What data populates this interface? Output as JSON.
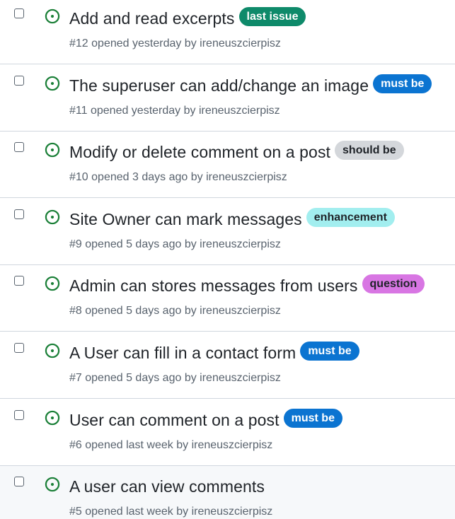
{
  "issues": [
    {
      "title": "Add and read excerpts",
      "number": "#12",
      "opened": "opened yesterday by",
      "author": "ireneuszcierpisz",
      "label": {
        "text": "last issue",
        "bg": "#0e8a6a",
        "fg": "#ffffff"
      },
      "icon": "issue-open-icon"
    },
    {
      "title": "The superuser can add/change an image",
      "number": "#11",
      "opened": "opened yesterday by",
      "author": "ireneuszcierpisz",
      "label": {
        "text": "must be",
        "bg": "#0b74d1",
        "fg": "#ffffff"
      },
      "icon": "issue-open-icon"
    },
    {
      "title": "Modify or delete comment on a post",
      "number": "#10",
      "opened": "opened 3 days ago by",
      "author": "ireneuszcierpisz",
      "label": {
        "text": "should be",
        "bg": "#d4d7db",
        "fg": "#1f2328"
      },
      "icon": "issue-open-icon"
    },
    {
      "title": "Site Owner can mark messages",
      "number": "#9",
      "opened": "opened 5 days ago by",
      "author": "ireneuszcierpisz",
      "label": {
        "text": "enhancement",
        "bg": "#a2eeef",
        "fg": "#1f2328"
      },
      "icon": "issue-open-icon"
    },
    {
      "title": "Admin can stores messages from users",
      "number": "#8",
      "opened": "opened 5 days ago by",
      "author": "ireneuszcierpisz",
      "label": {
        "text": "question",
        "bg": "#d876e3",
        "fg": "#1f2328"
      },
      "icon": "issue-open-icon"
    },
    {
      "title": "A User can fill in a contact form",
      "number": "#7",
      "opened": "opened 5 days ago by",
      "author": "ireneuszcierpisz",
      "label": {
        "text": "must be",
        "bg": "#0b74d1",
        "fg": "#ffffff"
      },
      "icon": "issue-open-icon"
    },
    {
      "title": "User can comment on a post",
      "number": "#6",
      "opened": "opened last week by",
      "author": "ireneuszcierpisz",
      "label": {
        "text": "must be",
        "bg": "#0b74d1",
        "fg": "#ffffff"
      },
      "icon": "issue-open-icon"
    },
    {
      "title": "A user can view comments",
      "number": "#5",
      "opened": "opened last week by",
      "author": "ireneuszcierpisz",
      "label": null,
      "icon": "issue-open-icon"
    }
  ],
  "colors": {
    "open_icon": "#1a7f37",
    "title": "#1f2328",
    "meta": "#59636e",
    "border": "#d0d7de",
    "hover_row_bg": "#f6f8fa"
  }
}
